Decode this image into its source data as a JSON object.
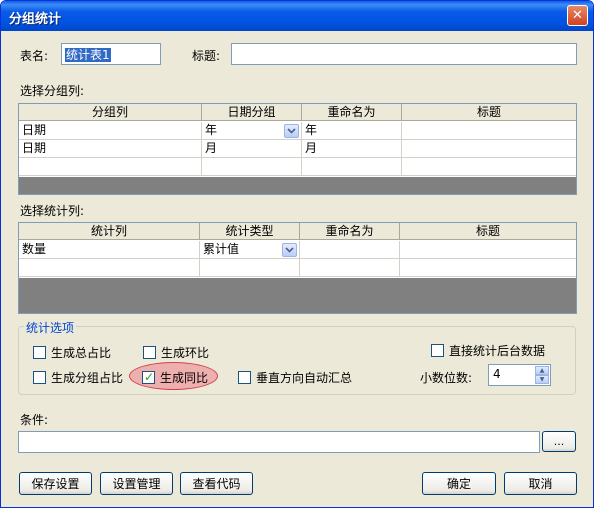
{
  "window": {
    "title": "分组统计",
    "close_glyph": "✕"
  },
  "form": {
    "table_name_label": "表名:",
    "table_name_value": "统计表1",
    "title_label": "标题:",
    "title_value": ""
  },
  "group_section": {
    "label": "选择分组列:",
    "columns": [
      "分组列",
      "日期分组",
      "重命名为",
      "标题"
    ],
    "rows": [
      [
        "日期",
        "年",
        "年",
        ""
      ],
      [
        "日期",
        "月",
        "月",
        ""
      ]
    ]
  },
  "stat_section": {
    "label": "选择统计列:",
    "columns": [
      "统计列",
      "统计类型",
      "重命名为",
      "标题"
    ],
    "rows": [
      [
        "数量",
        "累计值",
        "",
        ""
      ]
    ]
  },
  "options": {
    "legend": "统计选项",
    "total_ratio": {
      "label": "生成总占比",
      "checked": false
    },
    "ring_ratio": {
      "label": "生成环比",
      "checked": false
    },
    "group_ratio": {
      "label": "生成分组占比",
      "checked": false
    },
    "yoy_ratio": {
      "label": "生成同比",
      "checked": true
    },
    "vertical_sum": {
      "label": "垂直方向自动汇总",
      "checked": false
    },
    "backend_stat": {
      "label": "直接统计后台数据",
      "checked": false
    },
    "decimal_label": "小数位数:",
    "decimal_value": "4"
  },
  "condition": {
    "label": "条件:",
    "value": "",
    "browse_label": "..."
  },
  "buttons": {
    "save": "保存设置",
    "manage": "设置管理",
    "code": "查看代码",
    "ok": "确定",
    "cancel": "取消"
  },
  "icons": {
    "check": "✓",
    "combo": "chevron-down-icon",
    "spin_up": "▲",
    "spin_down": "▼"
  }
}
